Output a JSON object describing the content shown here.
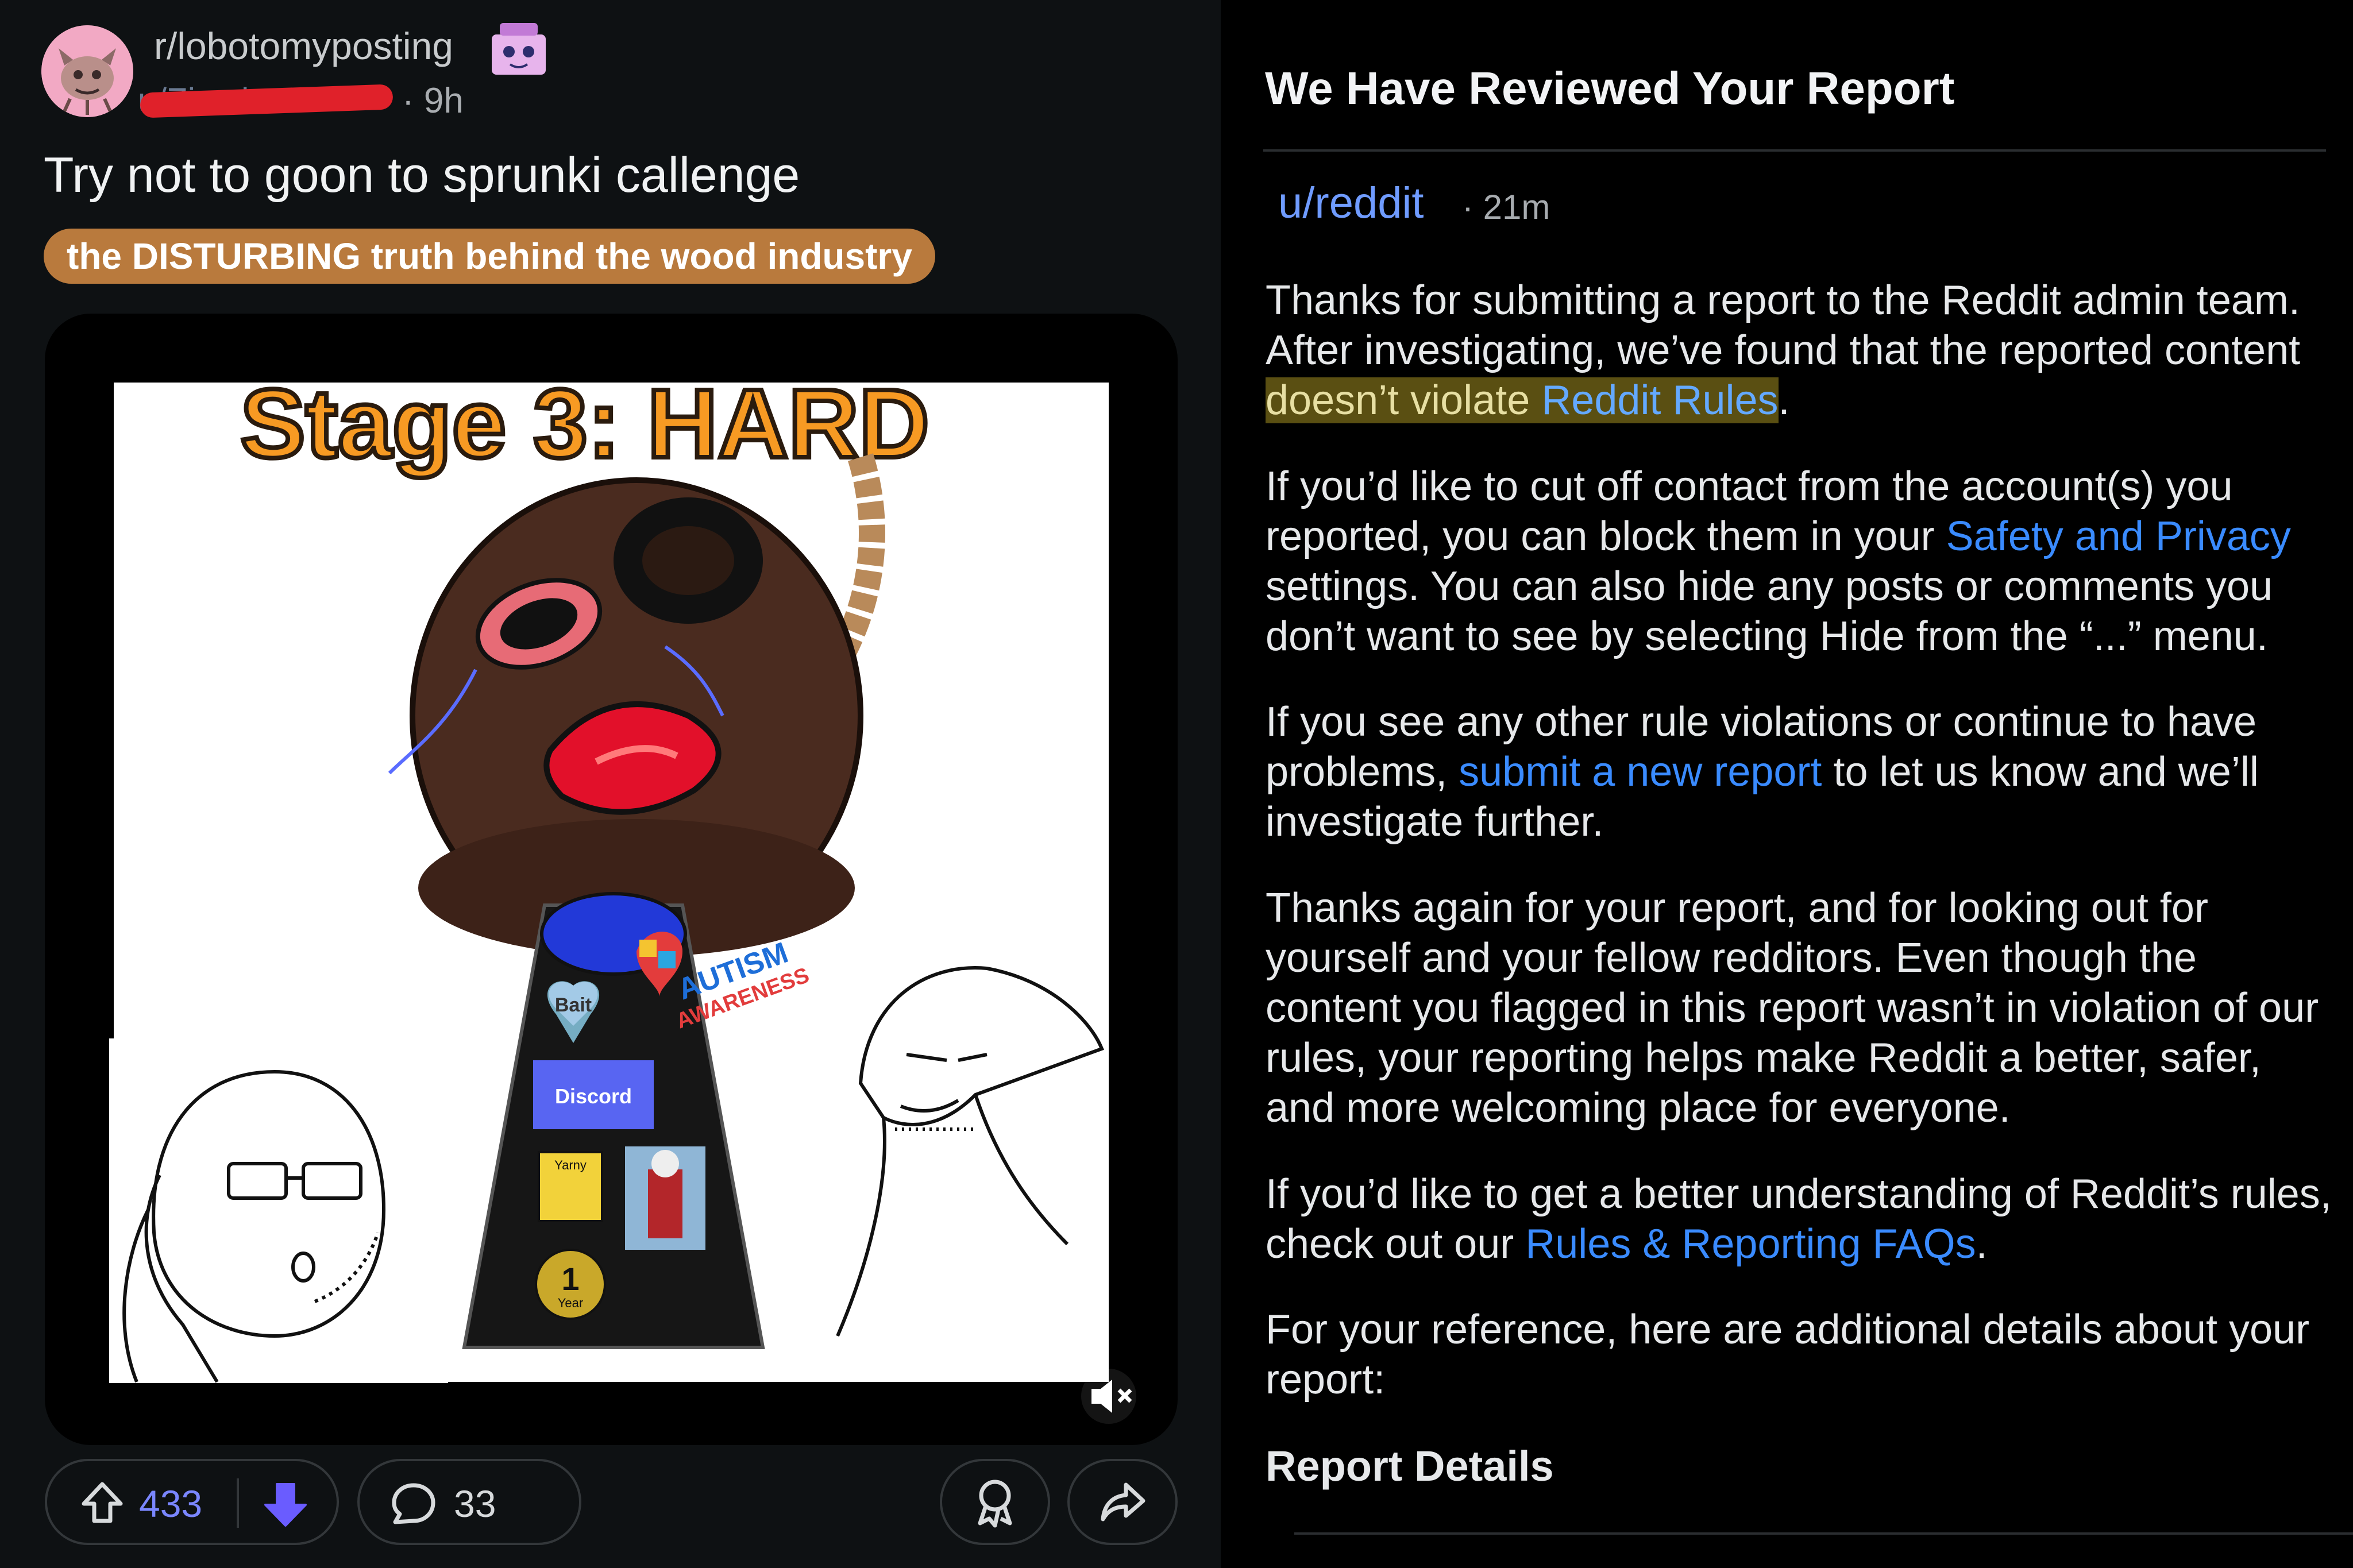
{
  "post": {
    "subreddit": "r/lobotomyposting",
    "author": "u/Zi…d",
    "time": "9h",
    "title": "Try not to goon to sprunki callenge",
    "flair": "the DISTURBING truth behind the wood industry",
    "media": {
      "stage_text": "Stage 3: HARD",
      "badge_bait": "Bait",
      "badge_autism": "AUTISM",
      "badge_awareness": "AWARENESS",
      "badge_discord": "Discord",
      "badge_medal_top": "Yarny",
      "badge_medal_number": "1",
      "badge_medal_unit": "Year"
    },
    "votes": "433",
    "comments": "33"
  },
  "report": {
    "title": "We Have Reviewed Your Report",
    "sender": "u/reddit",
    "time": "21m",
    "p1_start": "Thanks for submitting a report to the Reddit admin team. After investigating, we’ve found that the reported content ",
    "p1_highlight": "doesn’t violate ",
    "p1_link": "Reddit Rules",
    "p1_end": ".",
    "p2_start": "If you’d like to cut off contact from the account(s) you reported, you can block them in your ",
    "p2_link": "Safety and Privacy",
    "p2_end": " settings. You can also hide any posts or comments you don’t want to see by selecting Hide from the “...” menu.",
    "p3_start": "If you see any other rule violations or continue to have problems, ",
    "p3_link": "submit a new report",
    "p3_end": " to let us know and we’ll investigate further.",
    "p4": "Thanks again for your report, and for looking out for yourself and your fellow redditors. Even though the content you flagged in this report wasn’t in violation of our rules, your reporting helps make Reddit a better, safer, and more welcoming place for everyone.",
    "p5_start": "If you’d like to get a better understanding of Reddit’s rules, check out our ",
    "p5_link": "Rules & Reporting FAQs",
    "p5_end": ".",
    "p6": "For your reference, here are additional details about your report:",
    "details_heading": "Report Details"
  },
  "colors": {
    "link": "#3a8bff",
    "flair_bg": "#b97a3d",
    "upvote_count": "#7a86ff",
    "downvote_active": "#6a5cff",
    "highlight": "#5a4f12"
  },
  "icons": [
    "upvote-icon",
    "downvote-icon",
    "comment-icon",
    "award-icon",
    "share-icon",
    "mute-icon"
  ]
}
